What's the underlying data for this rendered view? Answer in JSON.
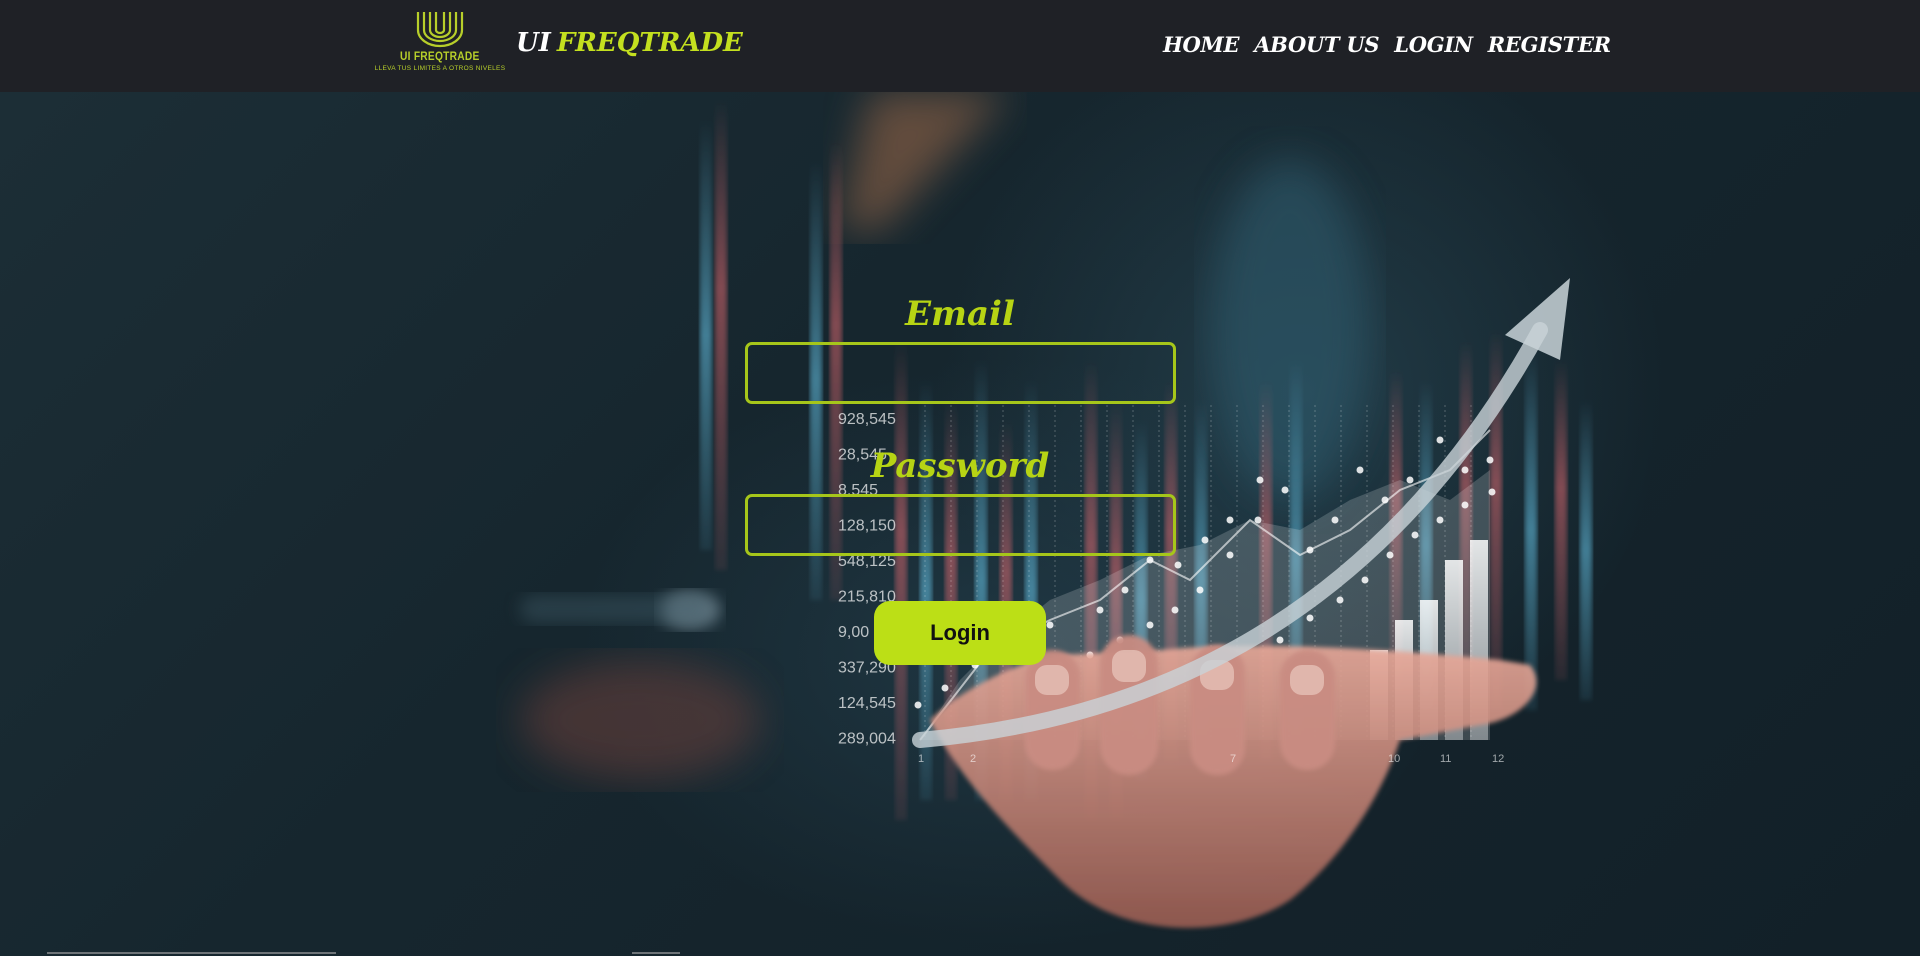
{
  "header": {
    "logo": {
      "name": "UI FREQTRADE",
      "tagline": "LLEVA TUS LIMITES A OTROS NIVELES"
    },
    "brand": {
      "part1": "UI",
      "part2": "FREQTRADE"
    },
    "nav": [
      "HOME",
      "ABOUT US",
      "LOGIN",
      "REGISTER"
    ]
  },
  "form": {
    "email_label": "Email",
    "email_value": "",
    "password_label": "Password",
    "password_value": "",
    "submit_label": "Login"
  },
  "background": {
    "axis_values": [
      "928,545",
      "28,545",
      "8,545",
      "128,150",
      "548,125",
      "215,810",
      "9,00",
      "337,290",
      "124,545",
      "289,004"
    ],
    "axis_ticks": [
      "1",
      "2",
      "7",
      "10",
      "11",
      "12"
    ]
  },
  "colors": {
    "accent": "#bcdf16",
    "navbar": "#1f2126",
    "background": "#15232b"
  }
}
